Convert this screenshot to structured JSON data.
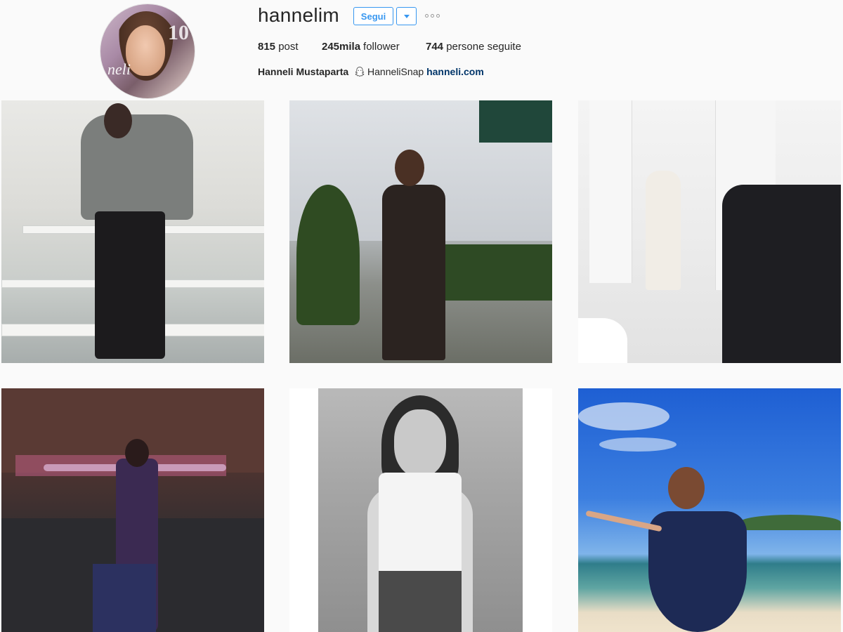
{
  "profile": {
    "username": "hannelim",
    "follow_label": "Segui",
    "avatar_cover_number": "10",
    "avatar_cover_title": "neli"
  },
  "stats": {
    "posts_count": "815",
    "posts_label": "post",
    "followers_count": "245mila",
    "followers_label": "follower",
    "following_count": "744",
    "following_label": "persone seguite"
  },
  "bio": {
    "full_name": "Hanneli Mustaparta",
    "snap_handle": "HanneliSnap",
    "website": "hanneli.com"
  },
  "colors": {
    "accent": "#3897f0",
    "link": "#003569",
    "background": "#fafafa"
  },
  "icons": {
    "dropdown": "chevron-down-icon",
    "more": "more-options-icon",
    "snapchat": "snapchat-ghost-icon"
  },
  "grid": {
    "posts": [
      {
        "id": "post-1"
      },
      {
        "id": "post-2"
      },
      {
        "id": "post-3"
      },
      {
        "id": "post-4"
      },
      {
        "id": "post-5"
      },
      {
        "id": "post-6"
      }
    ]
  }
}
